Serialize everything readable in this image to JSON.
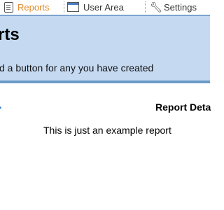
{
  "tabs": [
    {
      "label": "Reports",
      "icon": "report-icon",
      "active": true,
      "color": "#e08a2a"
    },
    {
      "label": "User Area",
      "icon": "window-icon",
      "active": false
    },
    {
      "label": "Settings",
      "icon": "tools-icon",
      "active": false
    }
  ],
  "header": {
    "title": "rts",
    "subtitle": "d a button for any you have created",
    "background": "#c5d9f1"
  },
  "content": {
    "details_heading": "Report Deta",
    "report_text": "This is just an example report"
  }
}
